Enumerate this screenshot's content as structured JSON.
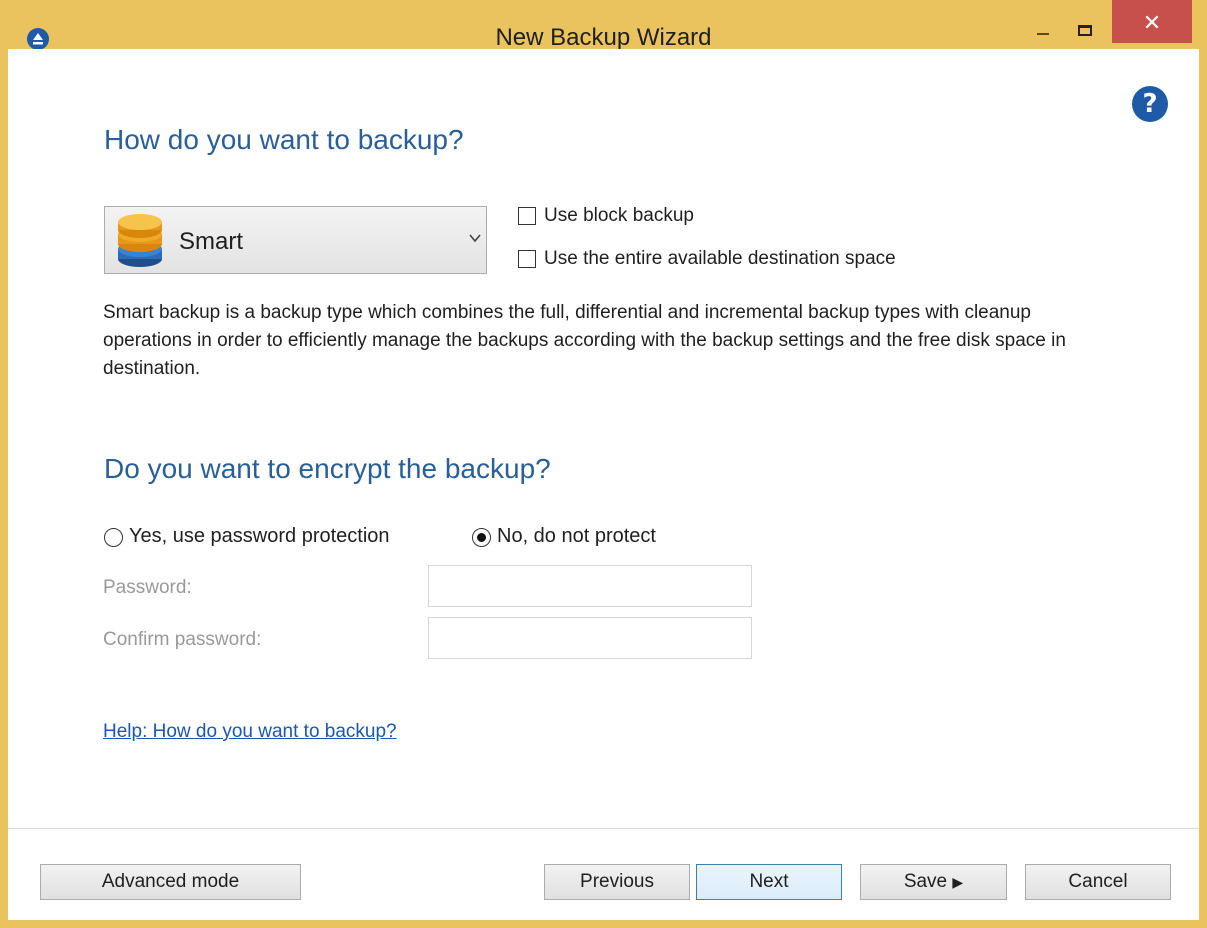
{
  "window": {
    "title": "New Backup Wizard",
    "close_glyph": "✕",
    "accent_color": "#EAC35E",
    "close_color": "#C7504B",
    "heading_color": "#2A5E99",
    "link_color": "#1A56B4"
  },
  "help_icon_glyph": "?",
  "backup_section": {
    "heading": "How do you want to backup?",
    "type_select": {
      "value": "Smart",
      "icon": "database-stack-icon"
    },
    "block_backup_label": "Use block backup",
    "block_backup_checked": false,
    "entire_space_label": "Use the entire available destination space",
    "entire_space_checked": false,
    "description": "Smart backup is a backup type which combines the full, differential and incremental backup types with cleanup operations in order to efficiently manage the backups according with the backup settings and the free disk space in destination."
  },
  "encrypt_section": {
    "heading": "Do you want to encrypt the backup?",
    "option_yes": "Yes, use password protection",
    "option_no": "No, do not protect",
    "selected": "no",
    "password_label": "Password:",
    "confirm_label": "Confirm password:",
    "password_value": "",
    "confirm_value": ""
  },
  "help_link": "Help: How do you want to backup?",
  "buttons": {
    "advanced": "Advanced mode",
    "previous": "Previous",
    "next": "Next",
    "save": "Save",
    "save_arrow": "▶",
    "cancel": "Cancel"
  }
}
